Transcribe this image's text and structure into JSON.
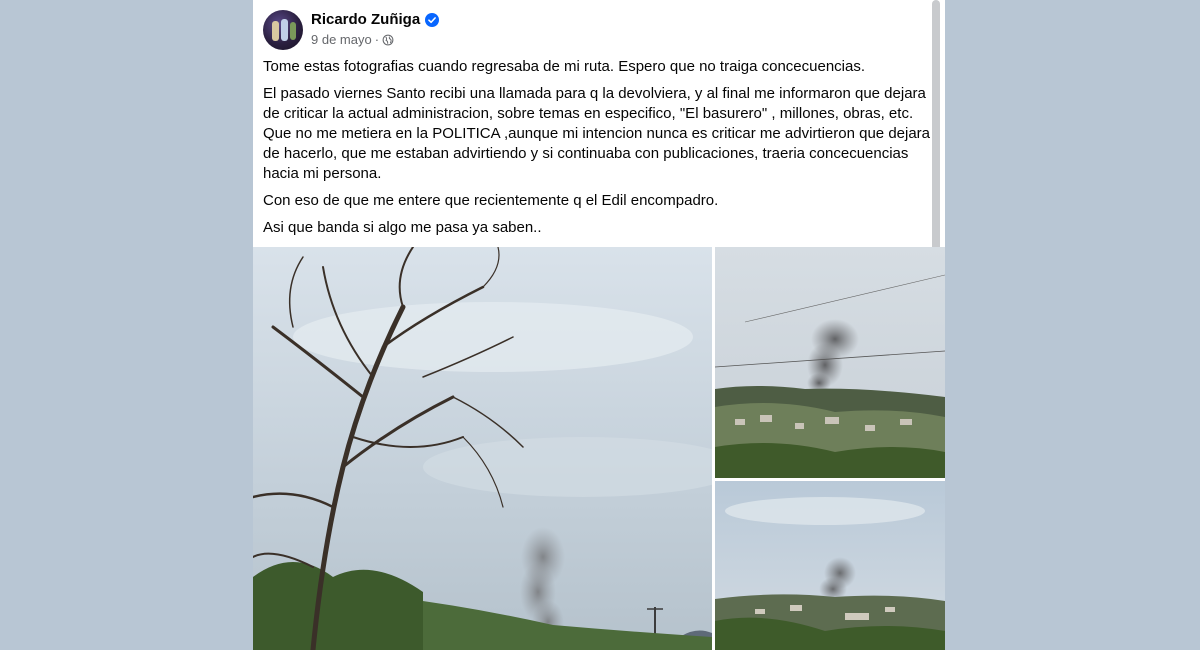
{
  "post": {
    "author": "Ricardo Zuñiga",
    "date": "9 de mayo",
    "separator": "·",
    "icons": {
      "verified": "verified-badge-icon",
      "audience": "globe-icon"
    },
    "paragraphs": [
      "Tome estas fotografias cuando regresaba de mi ruta. Espero que no traiga concecuencias.",
      "El pasado viernes Santo recibi una llamada para q la devolviera, y al final me informaron que dejara de criticar la actual administracion, sobre temas en especifico, \"El basurero\" , millones, obras, etc. Que no me metiera en la POLITICA ,aunque mi intencion nunca es criticar me advirtieron que dejara de hacerlo, que me estaban advirtiendo y si continuaba con publicaciones, traeria concecuencias hacia mi persona.",
      "Con eso de que me entere que recientemente q el Edil  encompadro.",
      "Asi que banda si algo me pasa ya saben.."
    ]
  },
  "colors": {
    "background": "#b8c6d4",
    "card": "#ffffff",
    "verified_blue": "#0866ff",
    "secondary_text": "#65676b"
  }
}
